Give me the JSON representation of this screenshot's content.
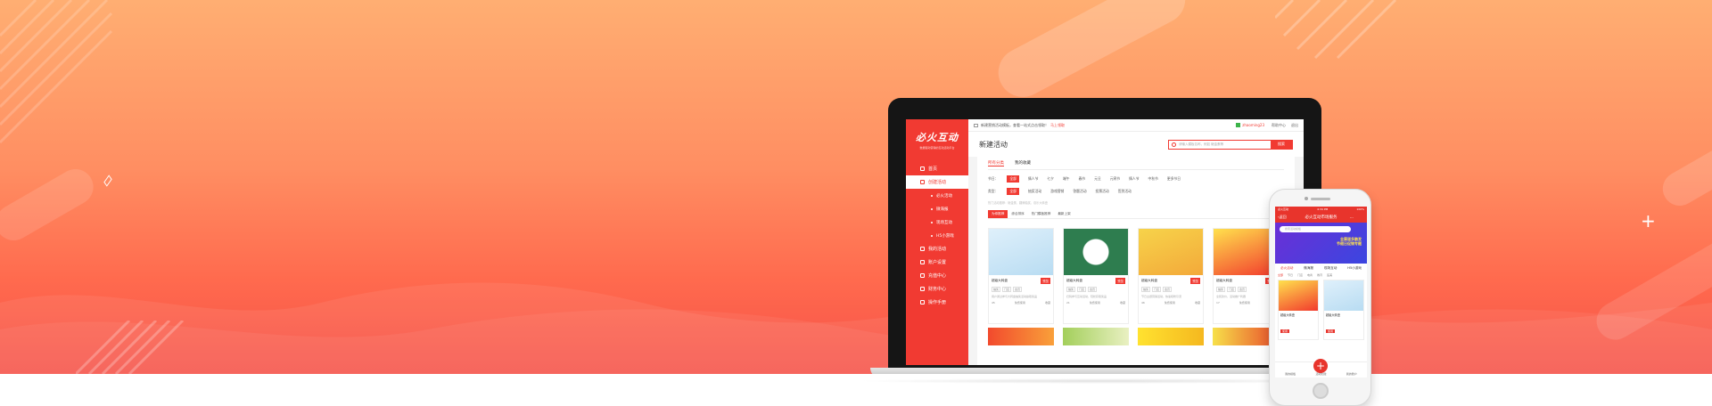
{
  "colors": {
    "brand": "#f13a32",
    "hero_top": "#ffae72",
    "hero_bottom": "#f65148"
  },
  "laptop": {
    "logo": "必火互动",
    "logo_sub": "数据驱动营销的互动活动平台",
    "menu": [
      {
        "label": "首页",
        "icon": "home-icon"
      },
      {
        "label": "创建活动",
        "icon": "create-icon",
        "active": true
      },
      {
        "label": "必火活动",
        "sub": true
      },
      {
        "label": "微海报",
        "sub": true
      },
      {
        "label": "现场互动",
        "sub": true
      },
      {
        "label": "H5小游戏",
        "sub": true
      },
      {
        "label": "我的活动",
        "icon": "list-icon"
      },
      {
        "label": "账户设置",
        "icon": "user-icon"
      },
      {
        "label": "充值中心",
        "icon": "wallet-icon"
      },
      {
        "label": "财务中心",
        "icon": "finance-icon"
      },
      {
        "label": "操作手册",
        "icon": "book-icon"
      }
    ],
    "topbar": {
      "notice": "新建营销活动模板，查看一站式点击领取！",
      "notice_link": "马上领取",
      "user": "zhaoming23",
      "help": "帮助中心",
      "logout": "退出"
    },
    "title": "新建活动",
    "search": {
      "placeholder": "请输入模板名称，例如 砸金蛋等",
      "button": "搜索"
    },
    "tabs": [
      "所有分类",
      "我的收藏"
    ],
    "filter_industry": {
      "label": "节日：",
      "items": [
        "全部",
        "情人节",
        "七夕",
        "端午",
        "春节",
        "元旦",
        "元宵节",
        "情人节",
        "中秋节",
        "更多节日"
      ]
    },
    "filter_type": {
      "label": "类型：",
      "items": [
        "全部",
        "抽奖活动",
        "游戏营销",
        "答题活动",
        "投票活动",
        "签到活动"
      ]
    },
    "hint": "热门活动推荐：砸金蛋、翻牌抽奖、欢乐大转盘",
    "tabs2": [
      "为你推荐",
      "综合排序",
      "热门模板推荐",
      "最新上架"
    ],
    "cards": [
      {
        "name": "超级大转盘",
        "btn": "预览",
        "tags": [
          "抽奖",
          "门店",
          "会员"
        ],
        "desc": "用户通过参与大转盘抽奖活动赢取奖品",
        "foot": [
          "45",
          "免费使用",
          "收藏"
        ]
      },
      {
        "name": "超级大转盘",
        "btn": "预览",
        "tags": [
          "抽奖",
          "门店",
          "会员"
        ],
        "desc": "扫码参与互动活动，轻松获取奖品",
        "foot": [
          "21",
          "免费使用",
          "收藏"
        ]
      },
      {
        "name": "超级大转盘",
        "btn": "预览",
        "tags": [
          "抽奖",
          "门店",
          "会员"
        ],
        "desc": "节日主题营销活动，快速吸粉引流",
        "foot": [
          "46",
          "免费使用",
          "收藏"
        ]
      },
      {
        "name": "超级大转盘",
        "btn": "预览",
        "tags": [
          "抽奖",
          "门店",
          "会员"
        ],
        "desc": "全民砍价，活动推广利器",
        "foot": [
          "17",
          "免费使用",
          "收藏"
        ]
      }
    ]
  },
  "phone": {
    "status_left": "必火互动",
    "status_time": "4:34 PM",
    "status_right": "100%",
    "back": "返回",
    "title": "必火互动市场服务",
    "search_placeholder": "搜索活动模板",
    "banner_text": "全渠道多触发\n节假日促销专题",
    "tabs": [
      "必火活动",
      "微海报",
      "现场互动",
      "H5小游戏"
    ],
    "filters": [
      "全部",
      "节日",
      "门店",
      "电商",
      "教育",
      "医美"
    ],
    "cards": [
      {
        "name": "超级大转盘",
        "btn": "使用"
      },
      {
        "name": "超级大转盘",
        "btn": "使用"
      }
    ],
    "tabbar": [
      "我的模板",
      "活动创建",
      "我的账户"
    ]
  }
}
